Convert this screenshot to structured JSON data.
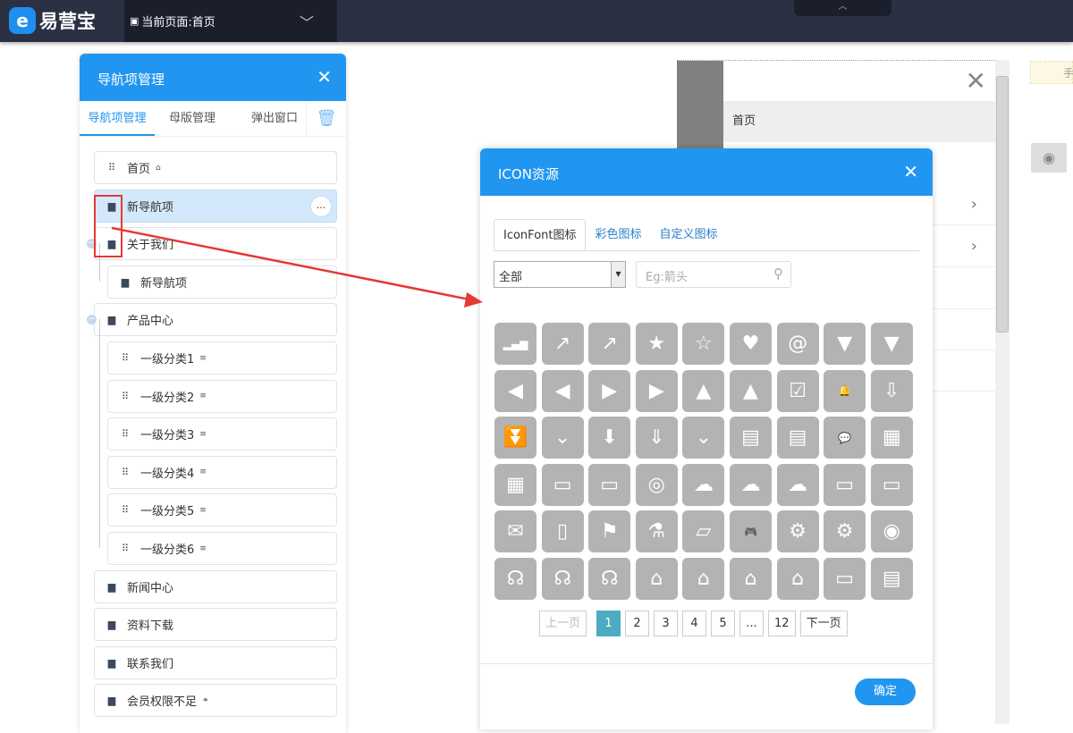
{
  "topbar": {
    "logo_text": "易营宝",
    "logo_glyph": "e",
    "current_page": "当前页面:首页"
  },
  "nav_panel": {
    "title": "导航项管理",
    "tabs": [
      "导航项管理",
      "母版管理",
      "弹出窗口"
    ],
    "items": [
      {
        "label": "首页",
        "icon": "grid-icon",
        "suffix": "⌂"
      },
      {
        "label": "新导航项",
        "icon": "page-icon",
        "selected": true
      },
      {
        "label": "关于我们",
        "icon": "page-icon"
      },
      {
        "label": "新导航项",
        "icon": "page-icon",
        "child": true
      },
      {
        "label": "产品中心",
        "icon": "page-icon"
      },
      {
        "label": "一级分类1",
        "icon": "grid-icon",
        "child": true,
        "suffix": "≡"
      },
      {
        "label": "一级分类2",
        "icon": "grid-icon",
        "child": true,
        "suffix": "≡"
      },
      {
        "label": "一级分类3",
        "icon": "grid-icon",
        "child": true,
        "suffix": "≡"
      },
      {
        "label": "一级分类4",
        "icon": "grid-icon",
        "child": true,
        "suffix": "≡"
      },
      {
        "label": "一级分类5",
        "icon": "grid-icon",
        "child": true,
        "suffix": "≡"
      },
      {
        "label": "一级分类6",
        "icon": "grid-icon",
        "child": true,
        "suffix": "≡"
      },
      {
        "label": "新闻中心",
        "icon": "page-icon"
      },
      {
        "label": "资料下载",
        "icon": "page-icon"
      },
      {
        "label": "联系我们",
        "icon": "page-icon"
      },
      {
        "label": "会员权限不足",
        "icon": "page-icon",
        "suffix": "⚭"
      }
    ],
    "more_label": "..."
  },
  "preview": {
    "first_item": "首页",
    "tip": "手"
  },
  "dialog": {
    "title": "ICON资源",
    "tabs": [
      "IconFont图标",
      "彩色图标",
      "自定义图标"
    ],
    "category": "全部",
    "search_placeholder": "Eg:箭头",
    "icons": [
      {
        "name": "bar-chart",
        "g": "▂▄▆"
      },
      {
        "name": "chart-up",
        "g": "↗"
      },
      {
        "name": "chart-up-alt",
        "g": "↗"
      },
      {
        "name": "star-plus",
        "g": "★"
      },
      {
        "name": "star-plus-outline",
        "g": "☆"
      },
      {
        "name": "heart",
        "g": "♥"
      },
      {
        "name": "at",
        "g": "@"
      },
      {
        "name": "arrow-down-fancy",
        "g": "▼"
      },
      {
        "name": "triangle-down",
        "g": "▼"
      },
      {
        "name": "arrow-left-fancy",
        "g": "◀"
      },
      {
        "name": "triangle-left",
        "g": "◀"
      },
      {
        "name": "arrow-right-fancy",
        "g": "▶"
      },
      {
        "name": "triangle-right",
        "g": "▶"
      },
      {
        "name": "arrow-up-fancy",
        "g": "▲"
      },
      {
        "name": "triangle-up",
        "g": "▲"
      },
      {
        "name": "briefcase-check",
        "g": "☑"
      },
      {
        "name": "bell",
        "g": "🔔"
      },
      {
        "name": "arrow-down-outline",
        "g": "⇩"
      },
      {
        "name": "double-chevron-down",
        "g": "⏬"
      },
      {
        "name": "double-chevron-down-outline",
        "g": "⌄"
      },
      {
        "name": "arrow-down",
        "g": "⬇"
      },
      {
        "name": "arrow-down-dashed",
        "g": "⇓"
      },
      {
        "name": "chevron-down",
        "g": "⌄"
      },
      {
        "name": "briefcase",
        "g": "▤"
      },
      {
        "name": "briefcase-outline",
        "g": "▤"
      },
      {
        "name": "chat",
        "g": "💬"
      },
      {
        "name": "calendar",
        "g": "▦"
      },
      {
        "name": "calendar-alt",
        "g": "▦"
      },
      {
        "name": "id-card",
        "g": "▭"
      },
      {
        "name": "id-card-outline",
        "g": "▭"
      },
      {
        "name": "badge",
        "g": "◎"
      },
      {
        "name": "cloud-code",
        "g": "☁"
      },
      {
        "name": "cloud-upload",
        "g": "☁"
      },
      {
        "name": "cloud-code-outline",
        "g": "☁"
      },
      {
        "name": "monitor",
        "g": "▭"
      },
      {
        "name": "monitor-alt",
        "g": "▭"
      },
      {
        "name": "envelope",
        "g": "✉"
      },
      {
        "name": "map",
        "g": "▯"
      },
      {
        "name": "flag",
        "g": "⚑"
      },
      {
        "name": "flask",
        "g": "⚗"
      },
      {
        "name": "folder-open",
        "g": "▱"
      },
      {
        "name": "gamepad",
        "g": "🎮"
      },
      {
        "name": "gears",
        "g": "⚙"
      },
      {
        "name": "gear",
        "g": "⚙"
      },
      {
        "name": "globe",
        "g": "◉"
      },
      {
        "name": "headset",
        "g": "☊"
      },
      {
        "name": "headphones",
        "g": "☊"
      },
      {
        "name": "headset-alt",
        "g": "☊"
      },
      {
        "name": "home",
        "g": "⌂"
      },
      {
        "name": "home-alt",
        "g": "⌂"
      },
      {
        "name": "home-outline",
        "g": "⌂"
      },
      {
        "name": "home-heart",
        "g": "⌂"
      },
      {
        "name": "inbox",
        "g": "▭"
      },
      {
        "name": "archive",
        "g": "▤"
      }
    ],
    "pagination": {
      "prev": "上一页",
      "pages": [
        "1",
        "2",
        "3",
        "4",
        "5",
        "...",
        "12"
      ],
      "current": "1",
      "next": "下一页"
    },
    "confirm": "确定"
  }
}
